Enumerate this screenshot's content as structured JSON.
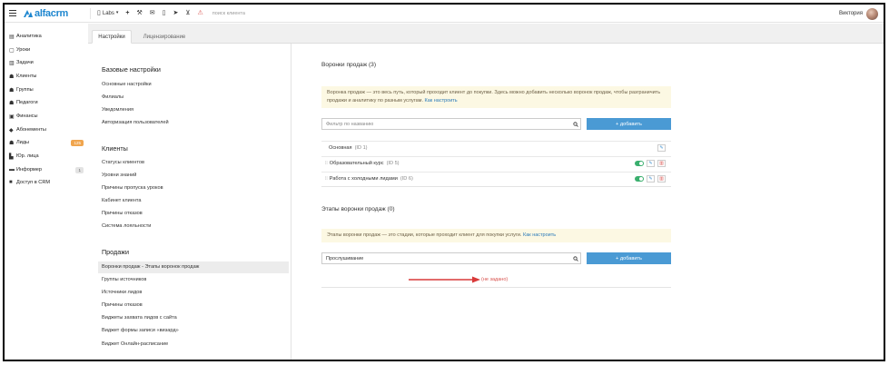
{
  "topbar": {
    "brand": "alfacrm",
    "branch": "Labs",
    "search_placeholder": "поиск клиента",
    "user_name": "Виктория",
    "icons": [
      "plus-icon",
      "wrench-icon",
      "mail-icon",
      "phone-icon",
      "send-icon",
      "cart-icon",
      "bell-icon"
    ]
  },
  "sidebar": {
    "items": [
      {
        "label": "Аналитика",
        "icon": "chart-icon",
        "glyph": "▤"
      },
      {
        "label": "Уроки",
        "icon": "calendar-icon",
        "glyph": "▢"
      },
      {
        "label": "Задачи",
        "icon": "tasks-icon",
        "glyph": "▥"
      },
      {
        "label": "Клиенты",
        "icon": "user-icon",
        "glyph": "☗"
      },
      {
        "label": "Группы",
        "icon": "users-icon",
        "glyph": "☗"
      },
      {
        "label": "Педагоги",
        "icon": "teacher-icon",
        "glyph": "☗"
      },
      {
        "label": "Финансы",
        "icon": "money-icon",
        "glyph": "▣"
      },
      {
        "label": "Абонементы",
        "icon": "tag-icon",
        "glyph": "◆"
      },
      {
        "label": "Лиды",
        "icon": "leads-icon",
        "glyph": "☗",
        "badge": "125"
      },
      {
        "label": "Юр. лица",
        "icon": "building-icon",
        "glyph": "▙"
      },
      {
        "label": "Информер",
        "icon": "informer-icon",
        "glyph": "▬",
        "badge": "1"
      },
      {
        "label": "Доступ в CRM",
        "icon": "lock-icon",
        "glyph": "🔒"
      }
    ]
  },
  "tabs": [
    {
      "label": "Настройки",
      "active": true
    },
    {
      "label": "Лицензирование",
      "active": false
    }
  ],
  "settings": {
    "basic_title": "Базовые настройки",
    "basic_links": [
      "Основные настройки",
      "Филиалы",
      "Уведомления",
      "Авторизация пользователей"
    ],
    "clients_title": "Клиенты",
    "clients_links": [
      "Статусы клиентов",
      "Уровни знаний",
      "Причины пропуска уроков",
      "Кабинет клиента",
      "Причины отказов",
      "Система лояльности"
    ],
    "sales_title": "Продажи",
    "sales_links": [
      "Воронки продаж - Этапы воронок продаж",
      "Группы источников",
      "Источники лидов",
      "Причины отказов",
      "Виджеты захвата лидов с сайта",
      "Виджет формы записи «визард»",
      "Виджет Онлайн-расписание"
    ]
  },
  "funnels": {
    "title": "Воронки продаж",
    "count": "(3)",
    "note_text": "Воронка продаж — это весь путь, который проходит клиент до покупки. Здесь можно добавить несколько воронок продаж, чтобы разграничить продажи и аналитику по разным услугам.",
    "note_link": "Как настроить",
    "filter_placeholder": "Фильтр по названию",
    "add_label": "+ добавить",
    "rows": [
      {
        "name": "Основная",
        "id": "(ID 1)"
      },
      {
        "name": "Образовательный курс",
        "id": "(ID 5)"
      },
      {
        "name": "Работа с холодными лидами",
        "id": "(ID 6)"
      }
    ]
  },
  "stages": {
    "title": "Этапы воронки продаж",
    "count": "(0)",
    "note_text": "Этапы воронки продаж — это стадии, которые проходит клиент для покупки услуги.",
    "note_link": "Как настроить",
    "filter_value": "Прослушивание",
    "add_label": "+ добавить",
    "empty_text": "(не задано)"
  },
  "colors": {
    "brand": "#1d86cf",
    "primary_button": "#4a9ad4",
    "toggle_on": "#3aaf6e",
    "badge": "#f0a54e",
    "note_bg": "#fcf8e3",
    "arrow": "#d93a3a"
  }
}
